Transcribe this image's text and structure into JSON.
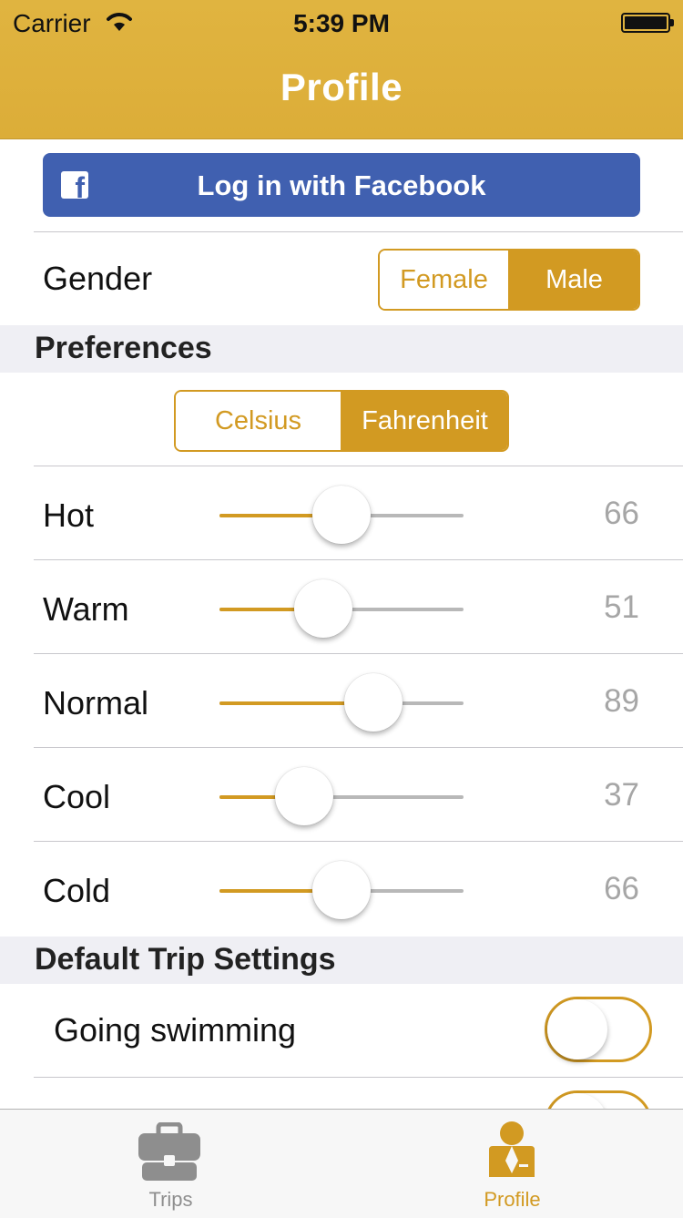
{
  "status_bar": {
    "carrier": "Carrier",
    "time": "5:39 PM"
  },
  "nav": {
    "title": "Profile"
  },
  "facebook": {
    "label": "Log in with Facebook",
    "icon": "facebook-icon"
  },
  "gender": {
    "label": "Gender",
    "options": [
      "Female",
      "Male"
    ],
    "selected": "Male"
  },
  "preferences": {
    "header": "Preferences",
    "units": {
      "options": [
        "Celsius",
        "Fahrenheit"
      ],
      "selected": "Fahrenheit"
    },
    "sliders": [
      {
        "label": "Hot",
        "value": "66",
        "fraction": 0.5
      },
      {
        "label": "Warm",
        "value": "51",
        "fraction": 0.4
      },
      {
        "label": "Normal",
        "value": "89",
        "fraction": 0.67
      },
      {
        "label": "Cool",
        "value": "37",
        "fraction": 0.3
      },
      {
        "label": "Cold",
        "value": "66",
        "fraction": 0.5
      }
    ]
  },
  "trip_settings": {
    "header": "Default Trip Settings",
    "toggles": [
      {
        "label": "Going swimming",
        "on": false
      }
    ]
  },
  "tabbar": {
    "tabs": [
      {
        "label": "Trips",
        "icon": "briefcase-icon",
        "active": false
      },
      {
        "label": "Profile",
        "icon": "person-icon",
        "active": true
      }
    ]
  },
  "colors": {
    "accent": "#d29a22",
    "header": "#dfb23c",
    "facebook": "#4060b0",
    "inactive_tab": "#8e8e8e"
  }
}
